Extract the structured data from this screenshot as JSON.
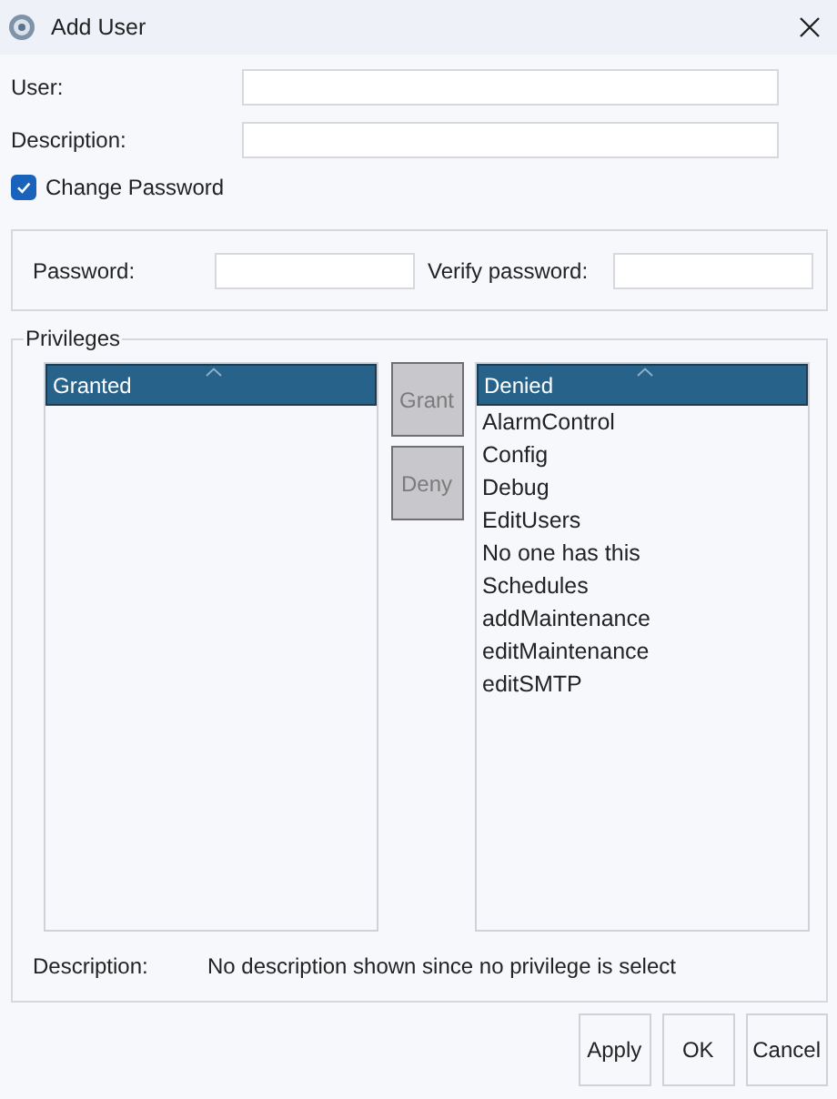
{
  "window": {
    "title": "Add User"
  },
  "fields": [
    {
      "label": "User:"
    },
    {
      "label": "Description:"
    }
  ],
  "change_password": {
    "label": "Change Password",
    "checked": true
  },
  "password_group": {
    "fields": [
      {
        "label": "Password:"
      },
      {
        "label": "Verify password:"
      }
    ]
  },
  "privileges": {
    "title": "Privileges",
    "granted": {
      "header": "Granted"
    },
    "actions": [
      {
        "label": "Grant",
        "disabled": true
      },
      {
        "label": "Deny",
        "disabled": true
      }
    ],
    "denied": {
      "header": "Denied",
      "items": [
        "AlarmControl",
        "Config",
        "Debug",
        "EditUsers",
        "No one has this",
        "Schedules",
        "addMaintenance",
        "editMaintenance",
        "editSMTP"
      ]
    },
    "description": {
      "label": "Description:",
      "text": "No description shown since no privilege is select"
    }
  },
  "buttons": [
    {
      "label": "Apply"
    },
    {
      "label": "OK"
    },
    {
      "label": "Cancel"
    }
  ]
}
